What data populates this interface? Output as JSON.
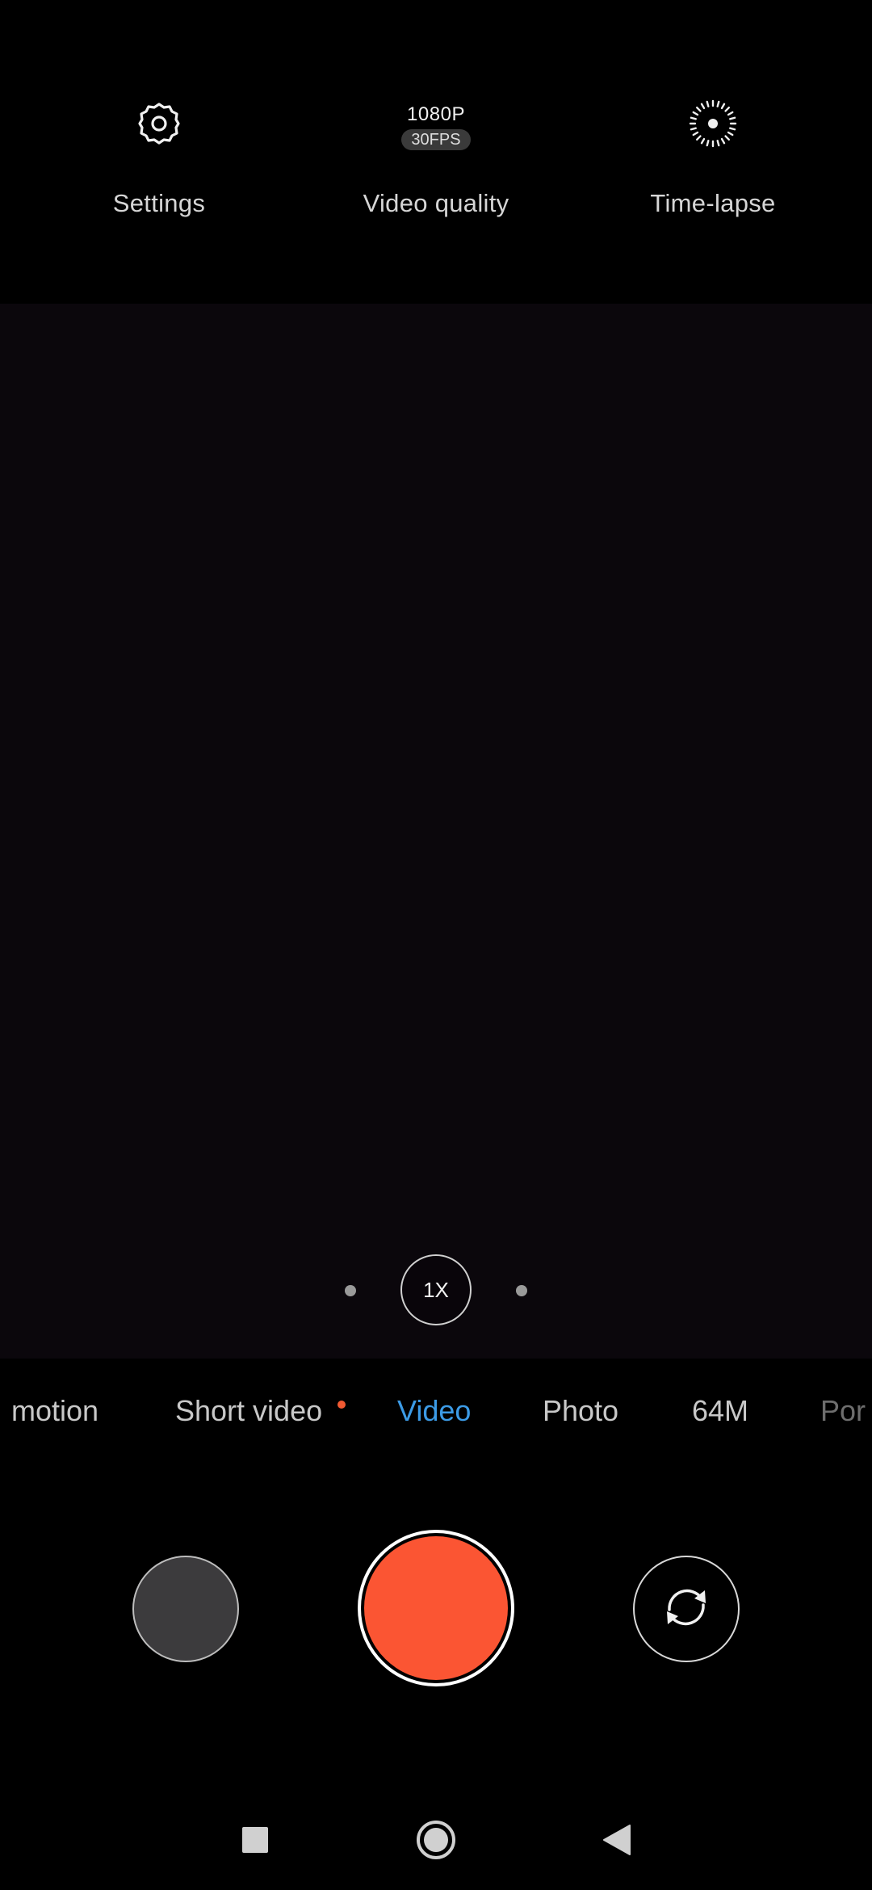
{
  "top_bar": {
    "settings": {
      "label": "Settings",
      "icon": "gear-icon"
    },
    "video_quality": {
      "label": "Video quality",
      "resolution": "1080P",
      "fps": "30FPS"
    },
    "time_lapse": {
      "label": "Time-lapse",
      "icon": "timelapse-icon"
    }
  },
  "zoom": {
    "level": "1X"
  },
  "modes": {
    "items": [
      "motion",
      "Short video",
      "Video",
      "Photo",
      "64M",
      "Por"
    ],
    "active": "Video"
  },
  "colors": {
    "accent": "#3c9be6",
    "shutter": "#fb5533",
    "notify_dot": "#f25a32"
  },
  "nav": {
    "recents_icon": "square-icon",
    "home_icon": "circle-icon",
    "back_icon": "triangle-back-icon"
  }
}
